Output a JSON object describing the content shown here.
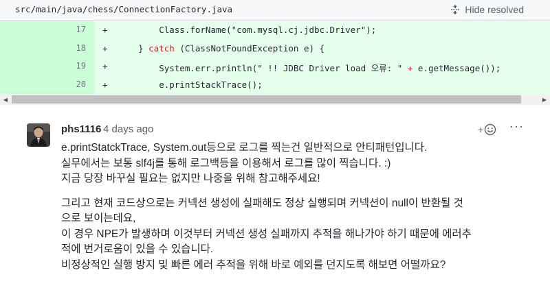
{
  "file": {
    "path": "src/main/java/chess/ConnectionFactory.java",
    "hide_resolved_label": "Hide resolved"
  },
  "diff": {
    "lines": [
      {
        "number": "17",
        "marker": "+",
        "pre": "        Class.forName(\"com.mysql.cj.jdbc.Driver\");",
        "keyword": "",
        "post": ""
      },
      {
        "number": "18",
        "marker": "+",
        "pre": "    } ",
        "keyword": "catch",
        "post": " (ClassNotFoundException e) {"
      },
      {
        "number": "19",
        "marker": "+",
        "pre": "        System.err.println(\" !! JDBC Driver load 오류: \" ",
        "keyword": "+",
        "post": " e.getMessage());"
      },
      {
        "number": "20",
        "marker": "+",
        "pre": "        e.printStackTrace();",
        "keyword": "",
        "post": ""
      }
    ]
  },
  "comment": {
    "author": "phs1116",
    "time": "4 days ago",
    "reaction_plus": "+",
    "more": "···",
    "paragraphs": [
      [
        "e.printStatckTrace, System.out등으로 로그를 찍는건 일반적으로 안티패턴입니다.",
        "실무에서는 보통 slf4j를 통해 로그백등을 이용해서 로그를 많이 찍습니다. :)",
        "지금 당장 바꾸실 필요는 없지만 나중을 위해 참고해주세요!"
      ],
      [
        "그리고 현재 코드상으로는 커넥션 생성에 실패해도 정상 실행되며 커넥션이 null이 반환될 것",
        "으로 보이는데요,",
        "이 경우 NPE가 발생하며 이것부터 커넥션 생성 실패까지 추적을 해나가야 하기 때문에 에러추",
        "적에 번거로움이 있을 수 있습니다.",
        "비정상적인 실행 방지 및 빠른 에러 추적을 위해 바로 예외를 던지도록 해보면 어떨까요?"
      ]
    ]
  },
  "colors": {
    "diff_background": "#e6ffec",
    "gutter_background": "#ccffd8",
    "keyword": "#cf222e"
  }
}
